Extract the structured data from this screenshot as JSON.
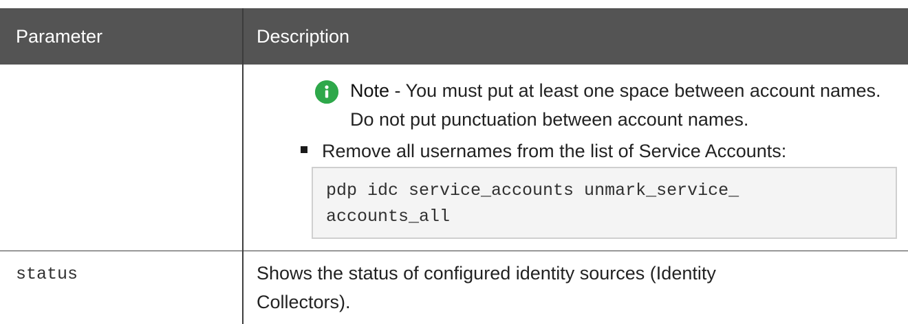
{
  "table": {
    "headers": {
      "parameter": "Parameter",
      "description": "Description"
    },
    "rows": [
      {
        "parameter": "",
        "description": {
          "note": {
            "label": "Note",
            "text": " - You must put at least one space between account names. Do not put punctuation between account names."
          },
          "bullet": "Remove all usernames from the list of Service Accounts:",
          "code_line_1": "pdp idc service_accounts unmark_service_",
          "code_line_2": "accounts_all"
        }
      },
      {
        "parameter": "status",
        "description": "Shows the status of configured identity sources (Identity Collectors)."
      }
    ]
  },
  "icons": {
    "note_icon": "info-icon",
    "bullet_icon": "square-bullet-icon"
  },
  "colors": {
    "header_background": "#545454",
    "header_text": "#ffffff",
    "note_icon": "#2ea84a",
    "code_background": "#f4f4f4",
    "code_border": "#cfcfcf"
  }
}
